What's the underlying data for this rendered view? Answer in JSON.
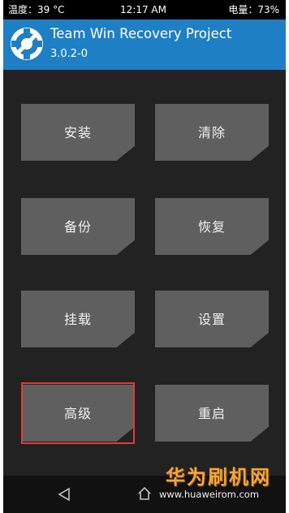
{
  "status_bar": {
    "temperature": "温度：39 °C",
    "time": "12:17 AM",
    "battery": "电量：73%"
  },
  "header": {
    "title": "Team Win Recovery Project",
    "version": "3.0.2-0",
    "logo_icon": "twrp-logo-icon",
    "accent_color": "#1f7fc4"
  },
  "main": {
    "buttons": [
      {
        "label": "安装"
      },
      {
        "label": "清除"
      },
      {
        "label": "备份"
      },
      {
        "label": "恢复"
      },
      {
        "label": "挂载"
      },
      {
        "label": "设置"
      },
      {
        "label": "高级",
        "highlighted": true,
        "highlight_color": "#e03a3a"
      },
      {
        "label": "重启"
      }
    ]
  },
  "navbar": {
    "back_icon": "back-triangle-icon",
    "home_icon": "home-icon"
  },
  "watermark": {
    "title": "华为刷机网",
    "url": "www.huaweirom.com"
  }
}
